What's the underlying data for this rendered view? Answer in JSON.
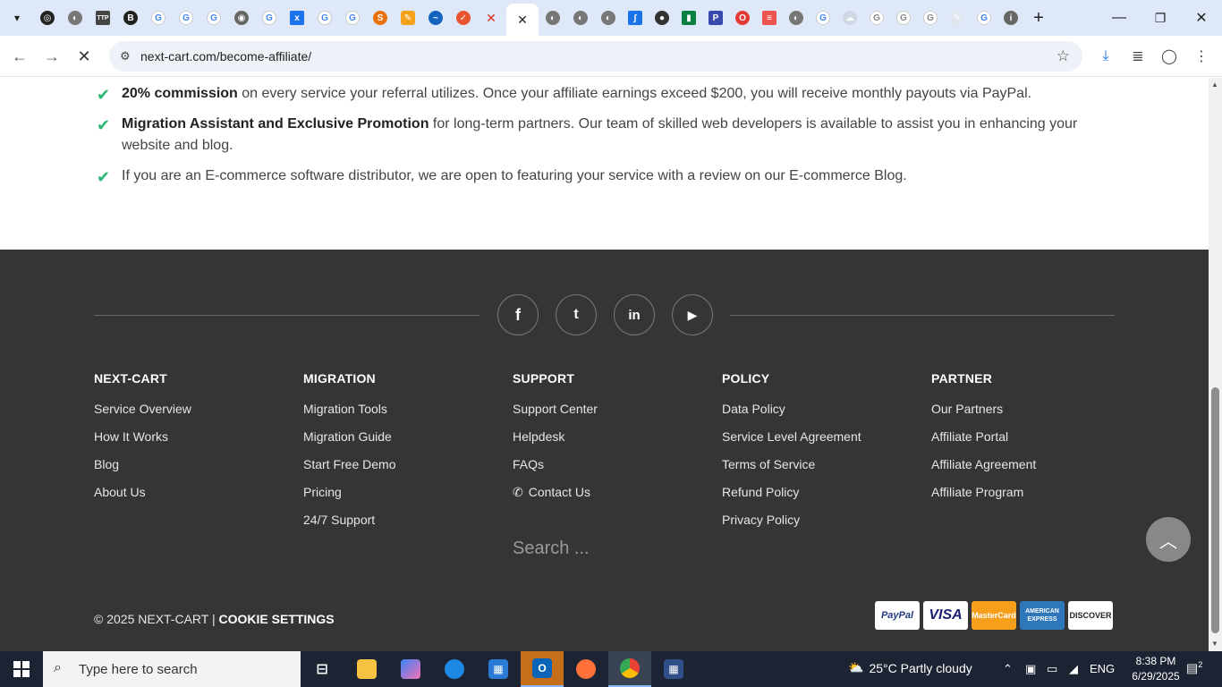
{
  "browser": {
    "url": "next-cart.com/become-affiliate/",
    "tab_close_glyph": "✕",
    "new_tab_glyph": "+",
    "window": {
      "minimize": "—",
      "restore": "❐",
      "close": "✕"
    }
  },
  "content": {
    "benefits": [
      {
        "bold": "20% commission",
        "text": " on every service your referral utilizes. Once your affiliate earnings exceed $200, you will receive monthly payouts via PayPal."
      },
      {
        "bold": "Migration Assistant and Exclusive Promotion",
        "text": " for long-term partners. Our team of skilled web developers is available to assist you in enhancing your website and blog."
      },
      {
        "bold": "",
        "text": "If you are an E-commerce software distributor, we are open to featuring your service with a review on our E-commerce Blog."
      }
    ]
  },
  "footer": {
    "social": [
      {
        "name": "facebook",
        "glyph": "f"
      },
      {
        "name": "twitter",
        "glyph": "t"
      },
      {
        "name": "linkedin",
        "glyph": "in"
      },
      {
        "name": "youtube",
        "glyph": "▶"
      }
    ],
    "columns": [
      {
        "heading": "NEXT-CART",
        "links": [
          "Service Overview",
          "How It Works",
          "Blog",
          "About Us"
        ]
      },
      {
        "heading": "MIGRATION",
        "links": [
          "Migration Tools",
          "Migration Guide",
          "Start Free Demo",
          "Pricing",
          "24/7 Support"
        ]
      },
      {
        "heading": "SUPPORT",
        "links": [
          "Support Center",
          "Helpdesk",
          "FAQs",
          "Contact Us"
        ]
      },
      {
        "heading": "POLICY",
        "links": [
          "Data Policy",
          "Service Level Agreement",
          "Terms of Service",
          "Refund Policy",
          "Privacy Policy"
        ]
      },
      {
        "heading": "PARTNER",
        "links": [
          "Our Partners",
          "Affiliate Portal",
          "Affiliate Agreement",
          "Affiliate Program"
        ]
      }
    ],
    "search_placeholder": "Search ...",
    "copyright": "© 2025 NEXT-CART | ",
    "cookie_settings": "COOKIE SETTINGS",
    "payments": [
      "PayPal",
      "VISA",
      "MasterCard",
      "AMERICAN EXPRESS",
      "DISCOVER"
    ]
  },
  "taskbar": {
    "search_placeholder": "Type here to search",
    "weather": "25°C  Partly cloudy",
    "language": "ENG",
    "time": "8:38 PM",
    "date": "6/29/2025",
    "notifications": "2"
  },
  "colors": {
    "accent_check": "#2bb673",
    "footer_bg": "#353535"
  }
}
